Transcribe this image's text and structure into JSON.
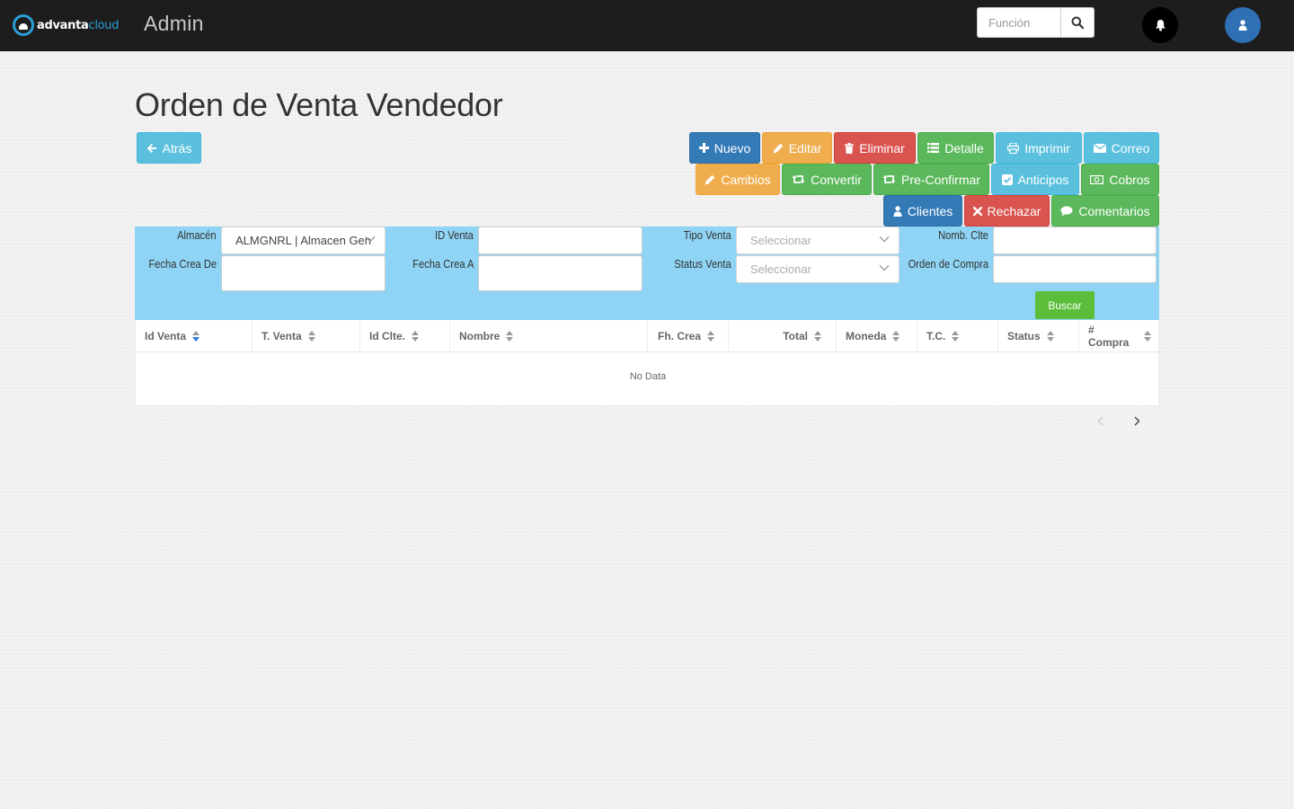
{
  "header": {
    "logo_text_a": "advanta",
    "logo_text_b": "cloud",
    "app_title": "Admin",
    "search_placeholder": "Función"
  },
  "page": {
    "title": "Orden de Venta Vendedor",
    "back_label": "Atrás"
  },
  "toolbar": {
    "nuevo": "Nuevo",
    "editar": "Editar",
    "eliminar": "Eliminar",
    "detalle": "Detalle",
    "imprimir": "Imprimir",
    "correo": "Correo",
    "cambios": "Cambios",
    "convertir": "Convertir",
    "preconfirmar": "Pre-Confirmar",
    "anticipos": "Anticipos",
    "cobros": "Cobros",
    "clientes": "Clientes",
    "rechazar": "Rechazar",
    "comentarios": "Comentarios"
  },
  "filters": {
    "almacen_label": "Almacén",
    "almacen_value": "ALMGNRL | Almacen General",
    "id_venta_label": "ID Venta",
    "tipo_venta_label": "Tipo Venta",
    "tipo_venta_placeholder": "Seleccionar",
    "nomb_clte_label": "Nomb. Clte",
    "fecha_crea_de_label": "Fecha Crea De",
    "fecha_crea_a_label": "Fecha Crea A",
    "status_venta_label": "Status Venta",
    "status_venta_placeholder": "Seleccionar",
    "orden_compra_label": "Orden de Compra",
    "buscar_label": "Buscar"
  },
  "table": {
    "columns": [
      "Id Venta",
      "T. Venta",
      "Id Clte.",
      "Nombre",
      "Fh. Crea",
      "Total",
      "Moneda",
      "T.C.",
      "Status",
      "# Compra"
    ],
    "empty_text": "No Data"
  },
  "colors": {
    "topbar": "#1d1d1d",
    "brand": "#2a9fd6",
    "filter_panel": "#8fd4f5",
    "buscar": "#5bbe3a"
  }
}
